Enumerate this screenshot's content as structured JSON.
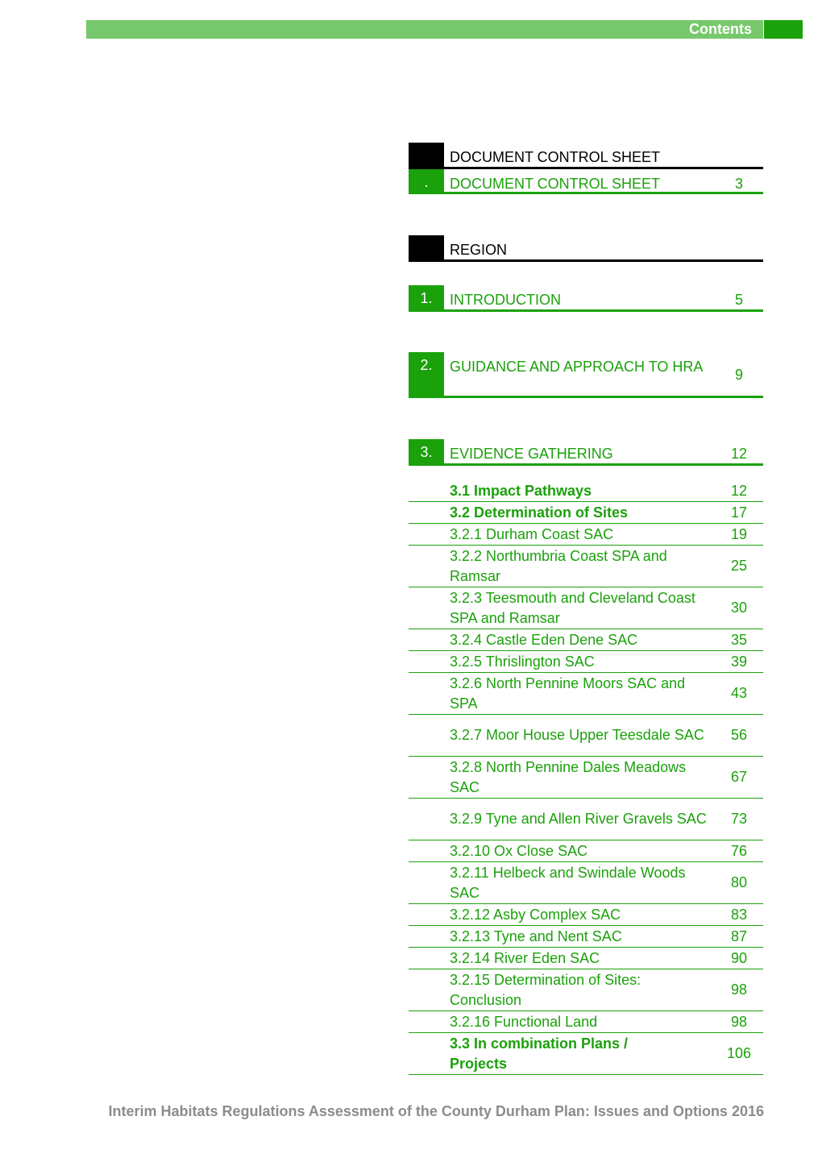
{
  "header": {
    "title": "Contents"
  },
  "chapters": [
    {
      "number": "",
      "title": "DOCUMENT CONTROL SHEET",
      "page": "",
      "style": "black"
    },
    {
      "number": ".",
      "title": "DOCUMENT CONTROL SHEET",
      "page": "3",
      "style": "green"
    },
    {
      "number": "",
      "title": "REGION",
      "page": "",
      "style": "black"
    },
    {
      "number": "1.",
      "title": "INTRODUCTION",
      "page": "5",
      "style": "green"
    },
    {
      "number": "2.",
      "title": "GUIDANCE AND APPROACH TO HRA",
      "page": "9",
      "style": "green"
    },
    {
      "number": "3.",
      "title": "EVIDENCE GATHERING",
      "page": "12",
      "style": "green"
    }
  ],
  "sections": [
    {
      "title": "3.1 Impact Pathways",
      "page": "12",
      "bold": true
    },
    {
      "title": "3.2 Determination of Sites",
      "page": "17",
      "bold": true
    },
    {
      "title": "3.2.1 Durham Coast SAC",
      "page": "19"
    },
    {
      "title": "3.2.2 Northumbria Coast SPA and Ramsar",
      "page": "25"
    },
    {
      "title": "3.2.3 Teesmouth and Cleveland Coast SPA and Ramsar",
      "page": "30"
    },
    {
      "title": "3.2.4 Castle Eden Dene SAC",
      "page": "35"
    },
    {
      "title": "3.2.5 Thrislington SAC",
      "page": "39"
    },
    {
      "title": "3.2.6 North Pennine Moors SAC and SPA",
      "page": "43"
    },
    {
      "title": "3.2.7 Moor House Upper Teesdale SAC",
      "page": "56"
    },
    {
      "title": "3.2.8 North Pennine Dales Meadows SAC",
      "page": "67"
    },
    {
      "title": "3.2.9 Tyne and Allen River Gravels SAC",
      "page": "73"
    },
    {
      "title": "3.2.10 Ox Close SAC",
      "page": "76"
    },
    {
      "title": "3.2.11 Helbeck and Swindale Woods SAC",
      "page": "80"
    },
    {
      "title": "3.2.12 Asby Complex SAC",
      "page": "83"
    },
    {
      "title": "3.2.13 Tyne and Nent SAC",
      "page": "87"
    },
    {
      "title": "3.2.14 River Eden SAC",
      "page": "90"
    },
    {
      "title": "3.2.15 Determination of Sites: Conclusion",
      "page": "98"
    },
    {
      "title": "3.2.16 Functional Land",
      "page": "98"
    },
    {
      "title": "3.3 In combination Plans / Projects",
      "page": "106",
      "bold": true
    }
  ],
  "footer": {
    "text": "Interim Habitats Regulations Assessment of the County Durham Plan: Issues and Options 2016"
  },
  "colors": {
    "accent": "#1ba10b",
    "header_bar": "#77c86c",
    "footer_text": "#8c8c8c"
  }
}
